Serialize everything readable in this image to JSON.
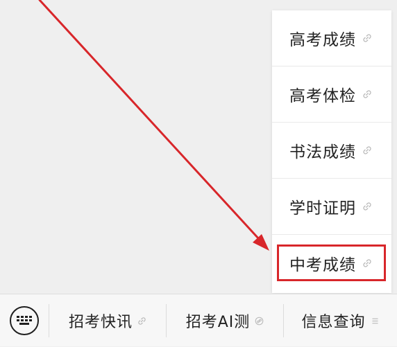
{
  "menu": {
    "items": [
      {
        "label": "高考成绩",
        "icon": "link-icon"
      },
      {
        "label": "高考体检",
        "icon": "link-icon"
      },
      {
        "label": "书法成绩",
        "icon": "link-icon"
      },
      {
        "label": "学时证明",
        "icon": "link-icon"
      },
      {
        "label": "中考成绩",
        "icon": "link-icon"
      }
    ],
    "highlighted_item": "中考成绩"
  },
  "bottom_bar": {
    "keyboard_icon": "keyboard-icon",
    "tabs": [
      {
        "label": "招考快讯",
        "icon": "link-icon"
      },
      {
        "label": "招考AI测",
        "icon": "mini-program-icon"
      },
      {
        "label": "信息查询",
        "icon": "menu-lines-icon"
      }
    ]
  },
  "colors": {
    "annotation_red": "#d8262a",
    "background": "#efefef",
    "menu_background": "#ffffff",
    "text": "#222222"
  }
}
